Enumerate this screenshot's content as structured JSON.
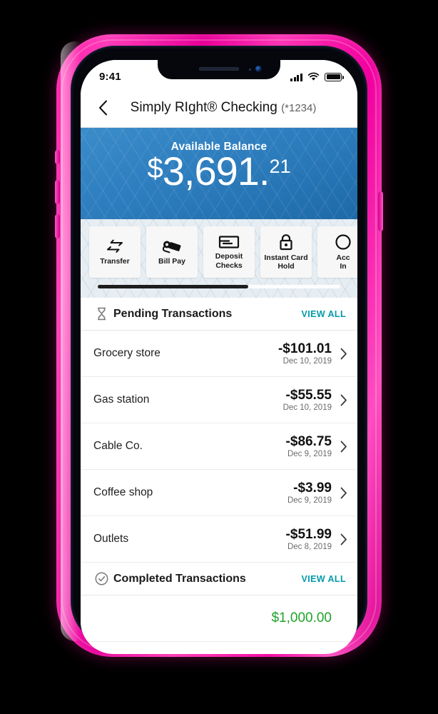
{
  "phone": {
    "case_color": "#ee0099",
    "body_color": "#05070d"
  },
  "status_bar": {
    "time": "9:41",
    "signal_icon": "signal-bars-icon",
    "wifi_icon": "wifi-icon",
    "battery_icon": "battery-icon"
  },
  "nav": {
    "back_icon": "chevron-left-icon",
    "title": "Simply RIght® Checking",
    "account_mask": "(*1234)"
  },
  "balance": {
    "label": "Available Balance",
    "currency": "$",
    "dollars": "3,691",
    "separator": ".",
    "cents": "21",
    "full": "$3,691.21",
    "bg_color": "#2f7fc0"
  },
  "quick_actions": {
    "scroll_progress": 62,
    "tiles": [
      {
        "label": "Transfer",
        "icon": "transfer-arrows-icon"
      },
      {
        "label": "Bill Pay",
        "icon": "hand-money-icon"
      },
      {
        "label": "Deposit\nChecks",
        "icon": "check-deposit-icon",
        "line1": "Deposit",
        "line2": "Checks"
      },
      {
        "label": "Instant Card\nHold",
        "icon": "padlock-icon",
        "line1": "Instant Card",
        "line2": "Hold"
      },
      {
        "label": "Acc\nIn",
        "icon": "account-info-icon",
        "line1": "Acc",
        "line2": "In"
      }
    ]
  },
  "pending": {
    "icon": "hourglass-icon",
    "title": "Pending Transactions",
    "view_all": "VIEW ALL",
    "view_all_color": "#009ba8",
    "rows": [
      {
        "name": "Grocery store",
        "amount": "-$101.01",
        "date": "Dec 10, 2019",
        "chevron": "chevron-right-icon"
      },
      {
        "name": "Gas station",
        "amount": "-$55.55",
        "date": "Dec 10, 2019",
        "chevron": "chevron-right-icon"
      },
      {
        "name": "Cable Co.",
        "amount": "-$86.75",
        "date": "Dec 9, 2019",
        "chevron": "chevron-right-icon"
      },
      {
        "name": "Coffee shop",
        "amount": "-$3.99",
        "date": "Dec 9, 2019",
        "chevron": "chevron-right-icon"
      },
      {
        "name": "Outlets",
        "amount": "-$51.99",
        "date": "Dec 8, 2019",
        "chevron": "chevron-right-icon"
      }
    ]
  },
  "completed": {
    "icon": "check-circle-icon",
    "title": "Completed Transactions",
    "view_all": "VIEW ALL",
    "rows": [
      {
        "name": "",
        "amount": "$1,000.00",
        "positive": true
      }
    ]
  }
}
